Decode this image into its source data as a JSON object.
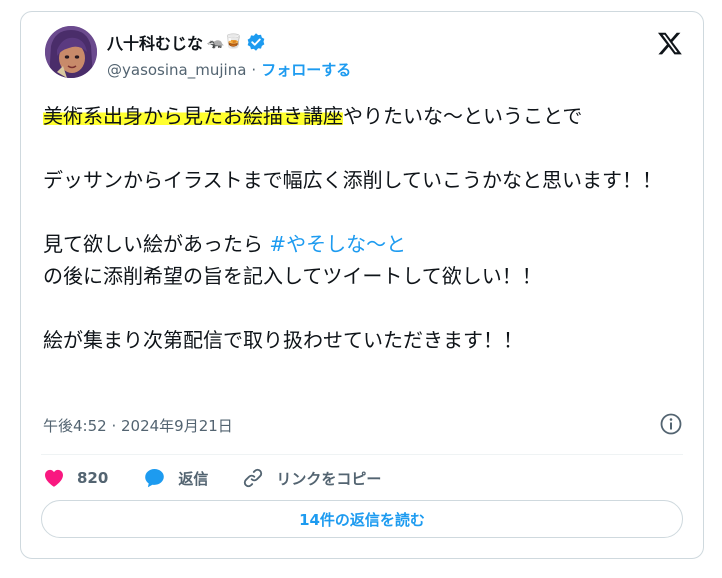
{
  "author": {
    "name": "八十科むじな",
    "name_emojis": "🦡🥃",
    "handle": "@yasosina_mujina",
    "separator": "·",
    "follow_label": "フォローする"
  },
  "tweet": {
    "highlight": "美術系出身から見たお絵描き講座",
    "line1_rest": "やりたいな〜ということで",
    "para2": "デッサンからイラストまで幅広く添削していこうかなと思います！！",
    "para3_pre": "見て欲しい絵があったら ",
    "hashtag": "#やそしな〜と",
    "para3_post": "の後に添削希望の旨を記入してツイートして欲しい！！",
    "para4": "絵が集まり次第配信で取り扱わせていただきます！！"
  },
  "meta": {
    "timestamp": "午後4:52 · 2024年9月21日"
  },
  "actions": {
    "like_count": "820",
    "reply_label": "返信",
    "copy_link_label": "リンクをコピー"
  },
  "replies_button": "14件の返信を読む",
  "colors": {
    "accent": "#1d9bf0",
    "like": "#f91880",
    "highlight": "#ffff2e",
    "muted": "#536471"
  },
  "icons": [
    "x-logo-icon",
    "verified-badge-icon",
    "info-icon",
    "heart-icon",
    "reply-bubble-icon",
    "link-icon"
  ]
}
